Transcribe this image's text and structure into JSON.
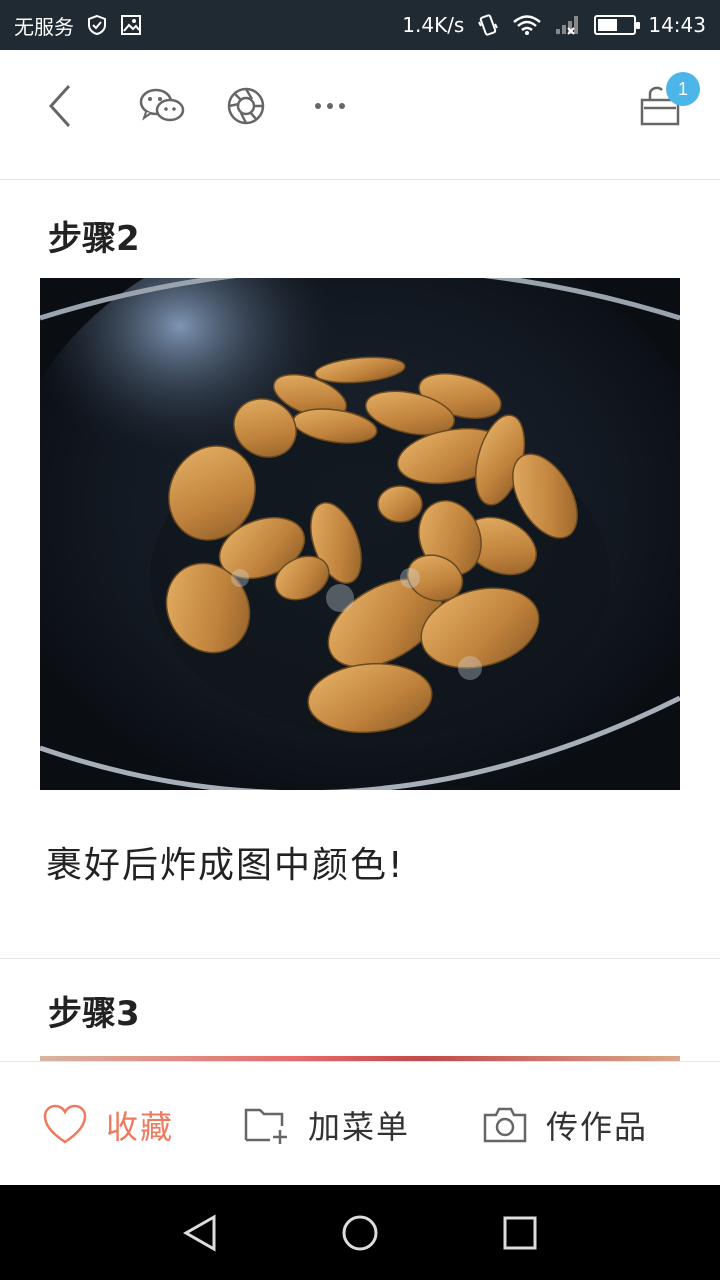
{
  "status_bar": {
    "carrier": "无服务",
    "net_speed": "1.4K/s",
    "time": "14:43",
    "battery_level": 0.55
  },
  "toolbar": {
    "cart_badge": "1",
    "icons": [
      "back-icon",
      "wechat-icon",
      "moments-icon",
      "more-icon",
      "basket-icon"
    ]
  },
  "steps": [
    {
      "title": "步骤2",
      "description": "裹好后炸成图中颜色!"
    },
    {
      "title": "步骤3"
    }
  ],
  "actions": {
    "favorite": "收藏",
    "add_menu": "加菜单",
    "upload_work": "传作品"
  },
  "colors": {
    "accent": "#f07a5e",
    "badge": "#4db6e8",
    "status_bar": "#1f2a33"
  }
}
